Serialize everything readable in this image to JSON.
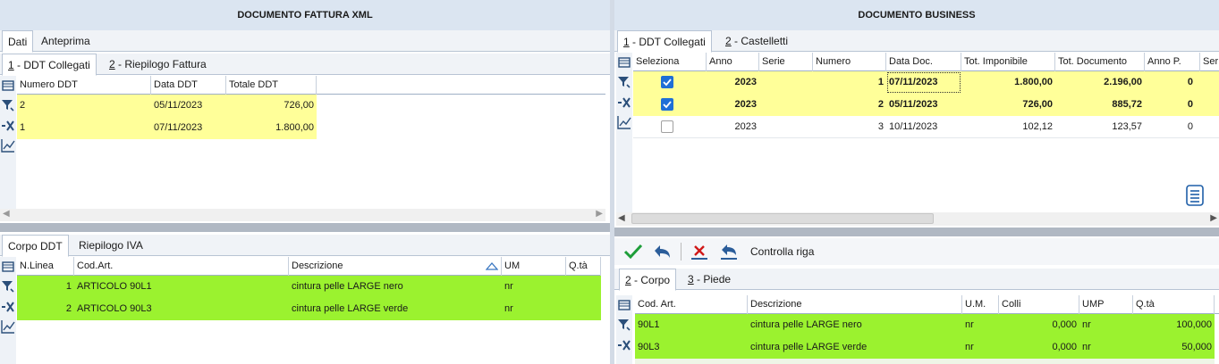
{
  "left": {
    "title": "DOCUMENTO FATTURA XML",
    "main_tabs": [
      {
        "label": "Dati"
      },
      {
        "label": "Anteprima"
      }
    ],
    "sub_tabs": [
      {
        "num": "1",
        "label": " - DDT Collegati"
      },
      {
        "num": "2",
        "label": " - Riepilogo Fattura"
      }
    ],
    "ddt_grid": {
      "columns": [
        "Numero DDT",
        "Data DDT",
        "Totale DDT"
      ],
      "rows": [
        {
          "numero": "2",
          "data": "05/11/2023",
          "totale": "726,00"
        },
        {
          "numero": "1",
          "data": "07/11/2023",
          "totale": "1.800,00"
        }
      ]
    },
    "lower_tabs": [
      {
        "label": "Corpo DDT"
      },
      {
        "label": "Riepilogo IVA"
      }
    ],
    "corpo_grid": {
      "columns": [
        "N.Linea",
        "Cod.Art.",
        "Descrizione",
        "UM",
        "Q.tà"
      ],
      "rows": [
        {
          "linea": "1",
          "cod": "ARTICOLO 90L1",
          "desc": "cintura pelle LARGE nero",
          "um": "nr"
        },
        {
          "linea": "2",
          "cod": "ARTICOLO 90L3",
          "desc": "cintura pelle LARGE verde",
          "um": "nr"
        }
      ]
    }
  },
  "right": {
    "title": "DOCUMENTO BUSINESS",
    "sub_tabs": [
      {
        "num": "1",
        "label": " - DDT Collegati"
      },
      {
        "num": "2",
        "label": " - Castelletti"
      }
    ],
    "ddt_grid": {
      "columns": [
        "Seleziona",
        "Anno",
        "Serie",
        "Numero",
        "Data Doc.",
        "Tot. Imponibile",
        "Tot. Documento",
        "Anno P.",
        "Ser"
      ],
      "rows": [
        {
          "checked": true,
          "anno": "2023",
          "serie": "",
          "numero": "1",
          "data": "07/11/2023",
          "imponibile": "1.800,00",
          "documento": "2.196,00",
          "annop": "0"
        },
        {
          "checked": true,
          "anno": "2023",
          "serie": "",
          "numero": "2",
          "data": "05/11/2023",
          "imponibile": "726,00",
          "documento": "885,72",
          "annop": "0"
        },
        {
          "checked": false,
          "anno": "2023",
          "serie": "",
          "numero": "3",
          "data": "10/11/2023",
          "imponibile": "102,12",
          "documento": "123,57",
          "annop": "0"
        }
      ]
    },
    "toolbar": {
      "controlla_label": "Controlla riga"
    },
    "lower_tabs": [
      {
        "num": "2",
        "label": " - Corpo"
      },
      {
        "num": "3",
        "label": " - Piede"
      }
    ],
    "corpo_grid": {
      "columns": [
        "Cod. Art.",
        "Descrizione",
        "U.M.",
        "Colli",
        "UMP",
        "Q.tà"
      ],
      "rows": [
        {
          "cod": "90L1",
          "desc": "cintura pelle LARGE nero",
          "um": "nr",
          "colli": "0,000",
          "ump": "nr",
          "qta": "100,000"
        },
        {
          "cod": "90L3",
          "desc": "cintura pelle LARGE verde",
          "um": "nr",
          "colli": "0,000",
          "ump": "nr",
          "qta": "50,000"
        }
      ]
    }
  },
  "colors": {
    "highlight_yellow": "#ffff99",
    "highlight_green": "#9bf22f",
    "title_bg": "#dbe5f1",
    "accent_blue": "#1f6fd6"
  }
}
